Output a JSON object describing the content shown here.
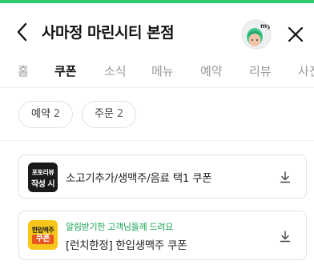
{
  "header": {
    "title": "사마정 마린시티 본점",
    "avatar_text": "my"
  },
  "tabs": [
    {
      "label": "홈"
    },
    {
      "label": "쿠폰"
    },
    {
      "label": "소식"
    },
    {
      "label": "메뉴"
    },
    {
      "label": "예약"
    },
    {
      "label": "리뷰"
    },
    {
      "label": "사진"
    }
  ],
  "active_tab": "쿠폰",
  "filters": [
    {
      "label": "예약",
      "count": "2"
    },
    {
      "label": "주문",
      "count": "2"
    }
  ],
  "coupons": [
    {
      "thumb_line1": "포토리뷰",
      "thumb_line2": "작성 시",
      "subtitle": "",
      "title": "소고기추가/생맥주/음료 택1 쿠폰"
    },
    {
      "thumb_line1": "한입맥주",
      "thumb_line2": "쿠폰",
      "subtitle": "알림받기한 고객님들께 드려요",
      "title": "[런치한정] 한입생맥주 쿠폰"
    }
  ],
  "colors": {
    "accent_green": "#2fc86f",
    "subtitle_green": "#17a553",
    "coupon_thumb_dark": "#1a1a1a",
    "coupon_thumb_yellow": "#f6c61b"
  },
  "icons": {
    "back": "chevron-left-icon",
    "close": "close-icon",
    "download": "download-icon",
    "avatar": "avatar"
  }
}
